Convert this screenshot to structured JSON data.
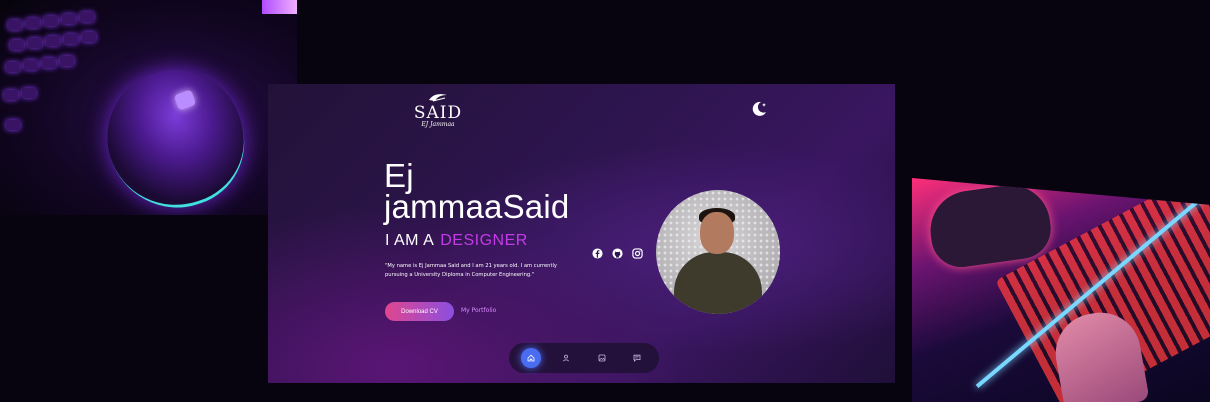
{
  "logo": {
    "main": "SAID",
    "sub": "EJ Jammaa"
  },
  "hero": {
    "name_line1": "Ej",
    "name_line2": "jammaaSaid",
    "role_prefix": "I AM A",
    "role_highlight": "DESIGNER",
    "bio": "\"My name is Ej Jammaa Said and I am 21 years old. I am currently pursuing a University Diploma in Computer Engineering.\"",
    "cta_primary": "Download CV",
    "cta_secondary": "My Portfolio"
  },
  "socials": [
    {
      "icon": "facebook-icon"
    },
    {
      "icon": "github-icon"
    },
    {
      "icon": "instagram-icon"
    }
  ],
  "nav": [
    {
      "icon": "home-icon",
      "active": true
    },
    {
      "icon": "user-icon",
      "active": false
    },
    {
      "icon": "gallery-icon",
      "active": false
    },
    {
      "icon": "message-icon",
      "active": false
    }
  ],
  "colors": {
    "accent": "#c33be6",
    "nav_active": "#4a6cf0",
    "button_start": "#e0468e",
    "button_end": "#8b4fe0"
  }
}
